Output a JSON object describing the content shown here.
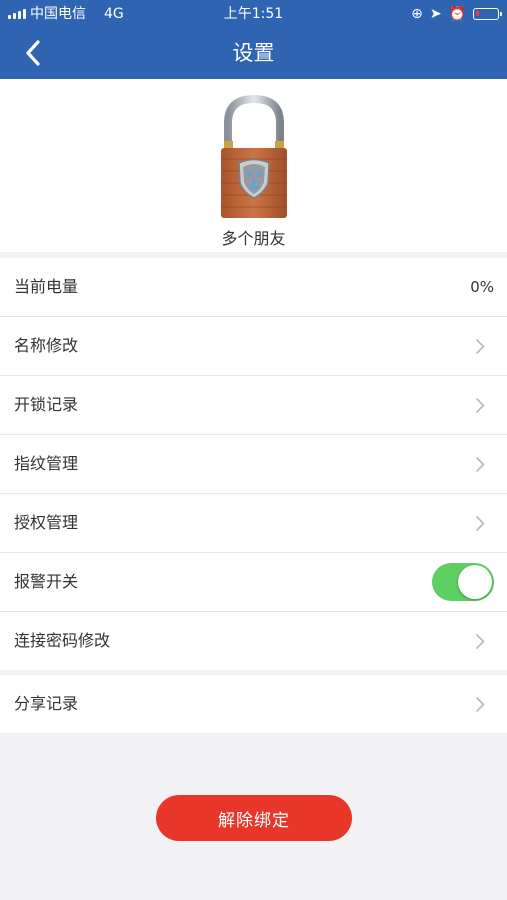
{
  "status_bar": {
    "carrier": "中国电信",
    "network": "4G",
    "time": "上午1:51",
    "battery_color": "#ff3b30"
  },
  "header": {
    "title": "设置",
    "back_icon": "chevron-left-icon",
    "background_color": "#2f64b3"
  },
  "device": {
    "name": "多个朋友",
    "image": "padlock-icon"
  },
  "settings": [
    {
      "label": "当前电量",
      "value": "0%"
    },
    {
      "label": "名称修改",
      "icon": "chevron-right-icon"
    },
    {
      "label": "开锁记录",
      "icon": "chevron-right-icon"
    },
    {
      "label": "指纹管理",
      "icon": "chevron-right-icon"
    },
    {
      "label": "授权管理",
      "icon": "chevron-right-icon"
    },
    {
      "label": "报警开关",
      "toggle_on": true,
      "toggle_color": "#5fcf63"
    },
    {
      "label": "连接密码修改",
      "icon": "chevron-right-icon"
    }
  ],
  "extra_settings": [
    {
      "label": "分享记录",
      "icon": "chevron-right-icon"
    }
  ],
  "unbind_button": {
    "label": "解除绑定",
    "color": "#e9362b"
  }
}
